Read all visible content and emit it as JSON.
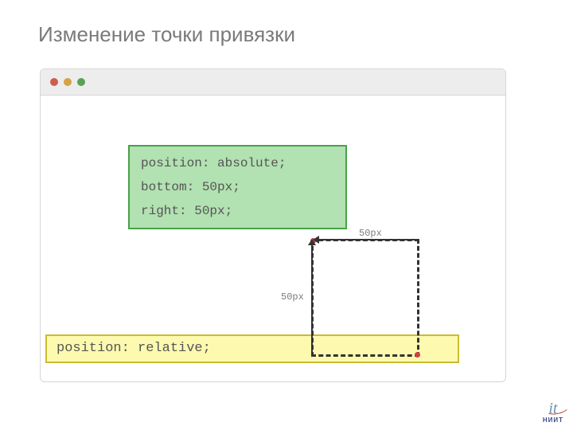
{
  "title": "Изменение точки привязки",
  "abs_box": {
    "line1": "position: absolute;",
    "line2": "bottom: 50px;",
    "line3": "right: 50px;"
  },
  "rel_box": {
    "text": "position: relative;"
  },
  "labels": {
    "horiz": "50px",
    "vert": "50px"
  },
  "footer": {
    "main": "it",
    "sub": "НИИТ"
  }
}
